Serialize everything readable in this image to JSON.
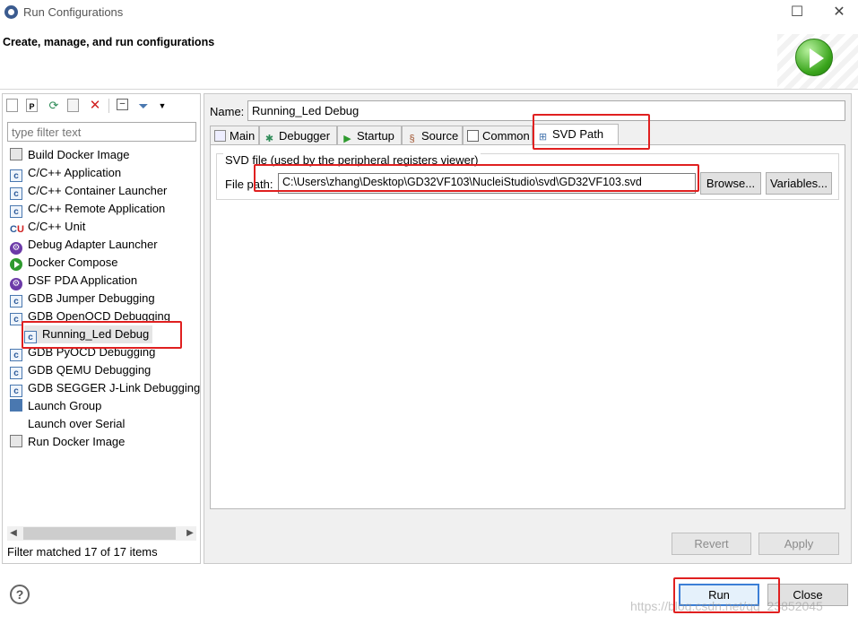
{
  "window": {
    "title": "Run Configurations",
    "minimize_glyph": "☐",
    "close_glyph": "✕"
  },
  "header": {
    "title": "Create, manage, and run configurations"
  },
  "toolbar": {
    "icons": [
      "new-config-icon",
      "new-prototype-icon",
      "export-icon",
      "duplicate-icon",
      "delete-icon",
      "collapse-all-icon",
      "filter-icon",
      "view-menu-icon"
    ]
  },
  "filter": {
    "placeholder": "type filter text",
    "status": "Filter matched 17 of 17 items"
  },
  "tree": {
    "items": [
      {
        "label": "Build Docker Image",
        "icon": "docker-icon"
      },
      {
        "label": "C/C++ Application",
        "icon": "c-icon"
      },
      {
        "label": "C/C++ Container Launcher",
        "icon": "c-icon"
      },
      {
        "label": "C/C++ Remote Application",
        "icon": "c-icon"
      },
      {
        "label": "C/C++ Unit",
        "icon": "cu-icon"
      },
      {
        "label": "Debug Adapter Launcher",
        "icon": "gear-icon"
      },
      {
        "label": "Docker Compose",
        "icon": "compose-icon"
      },
      {
        "label": "DSF PDA Application",
        "icon": "gear-icon"
      },
      {
        "label": "GDB Jumper Debugging",
        "icon": "c-icon"
      },
      {
        "label": "GDB OpenOCD Debugging",
        "icon": "c-icon"
      },
      {
        "label": "Running_Led Debug",
        "icon": "c-icon"
      },
      {
        "label": "GDB PyOCD Debugging",
        "icon": "c-icon"
      },
      {
        "label": "GDB QEMU Debugging",
        "icon": "c-icon"
      },
      {
        "label": "GDB SEGGER J-Link Debugging",
        "icon": "c-icon"
      },
      {
        "label": "Launch Group",
        "icon": "launch-group-icon"
      },
      {
        "label": "Launch over Serial",
        "icon": ""
      },
      {
        "label": "Run Docker Image",
        "icon": "docker-icon"
      }
    ]
  },
  "config": {
    "name_label": "Name:",
    "name_value": "Running_Led Debug",
    "tabs": [
      {
        "label": "Main",
        "icon": "main-tab-icon"
      },
      {
        "label": "Debugger",
        "icon": "debugger-tab-icon"
      },
      {
        "label": "Startup",
        "icon": "startup-tab-icon"
      },
      {
        "label": "Source",
        "icon": "source-tab-icon"
      },
      {
        "label": "Common",
        "icon": "common-tab-icon"
      },
      {
        "label": "SVD Path",
        "icon": "svd-tab-icon"
      }
    ],
    "svd_group_title": "SVD file (used by the peripheral registers viewer)",
    "file_path_label": "File path:",
    "file_path_value": "C:\\Users\\zhang\\Desktop\\GD32VF103\\NucleiStudio\\svd\\GD32VF103.svd",
    "browse_label": "Browse...",
    "variables_label": "Variables...",
    "revert_label": "Revert",
    "apply_label": "Apply"
  },
  "footer": {
    "run_label": "Run",
    "close_label": "Close",
    "help_glyph": "?",
    "watermark": "https://blog.csdn.net/qq_23852045"
  },
  "colors": {
    "highlight": "#e02020",
    "default_button_border": "#3c7fd6"
  }
}
